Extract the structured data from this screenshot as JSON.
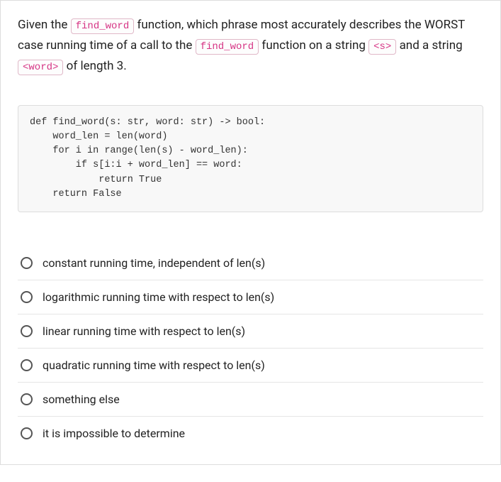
{
  "question": {
    "prefix1": "Given the ",
    "token1": "find_word",
    "mid1": " function, which phrase most accurately describes the WORST case running time of a call to the ",
    "token2": "find_word",
    "mid2": " function on a string ",
    "token3": "<s>",
    "mid3": " and a string ",
    "token4": "<word>",
    "suffix": " of length 3."
  },
  "code_block": "def find_word(s: str, word: str) -> bool:\n    word_len = len(word)\n    for i in range(len(s) - word_len):\n        if s[i:i + word_len] == word:\n            return True\n    return False",
  "options": [
    {
      "label": "constant running time, independent of len(s)"
    },
    {
      "label": "logarithmic running time with respect to len(s)"
    },
    {
      "label": "linear running time with respect to len(s)"
    },
    {
      "label": "quadratic running time with respect to len(s)"
    },
    {
      "label": "something else"
    },
    {
      "label": "it is impossible to determine"
    }
  ]
}
